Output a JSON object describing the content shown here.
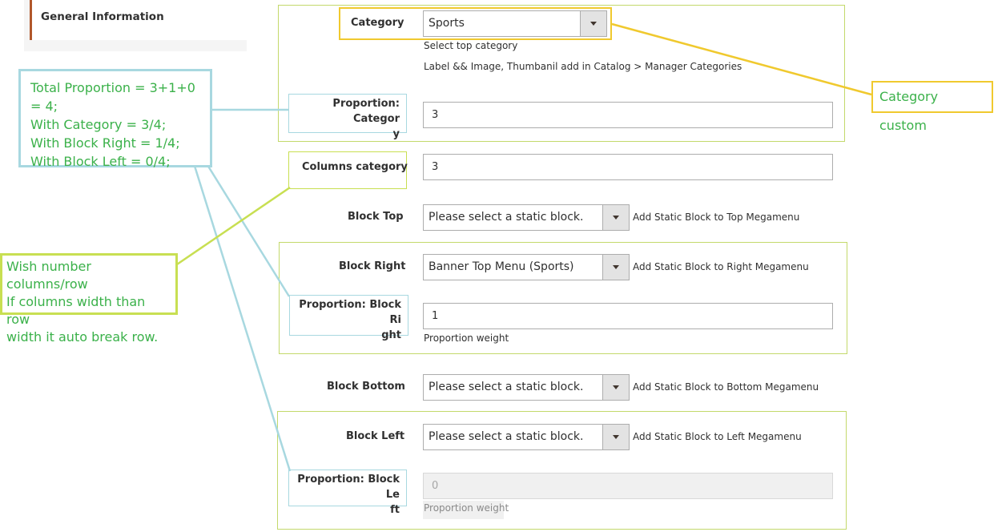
{
  "sidebar": {
    "general_information": "General Information"
  },
  "category": {
    "label": "Category",
    "value": "Sports",
    "hint1": "Select top category",
    "hint2": "Label && Image, Thumbanil add in Catalog > Manager Categories"
  },
  "proportion_category": {
    "label_line1": "Proportion: Categor",
    "label_line2": "y",
    "value": "3"
  },
  "columns_category": {
    "label": "Columns category",
    "value": "3"
  },
  "block_top": {
    "label": "Block Top",
    "value": "Please select a static block.",
    "hint": "Add Static Block to Top Megamenu"
  },
  "block_right": {
    "label": "Block Right",
    "value": "Banner Top Menu (Sports)",
    "hint": "Add Static Block to Right Megamenu"
  },
  "proportion_block_right": {
    "label_line1": "Proportion: Block Ri",
    "label_line2": "ght",
    "value": "1",
    "hint": "Proportion weight"
  },
  "block_bottom": {
    "label": "Block Bottom",
    "value": "Please select a static block.",
    "hint": "Add Static Block to Bottom Megamenu"
  },
  "block_left": {
    "label": "Block Left",
    "value": "Please select a static block.",
    "hint": "Add Static Block to Left Megamenu"
  },
  "proportion_block_left": {
    "label_line1": "Proportion: Block Le",
    "label_line2": "ft",
    "value": "0",
    "hint": "Proportion weight"
  },
  "annotations": {
    "category_custom": "Category custom",
    "proportion_lines": [
      "Total Proportion = 3+1+0 = 4;",
      "With Category = 3/4;",
      "With Block Right = 1/4;",
      "With Block Left = 0/4;"
    ],
    "columns_lines": [
      "Wish number columns/row",
      "If columns width than row",
      "width it auto break row."
    ]
  },
  "colors": {
    "annotation_text": "#3bb14a",
    "yellow": "#f0c92e",
    "light_blue": "#a8d8e0",
    "lime": "#c8df52",
    "tab_accent": "#b1572b"
  },
  "icons": {
    "select_arrow": "chevron-down-icon"
  }
}
